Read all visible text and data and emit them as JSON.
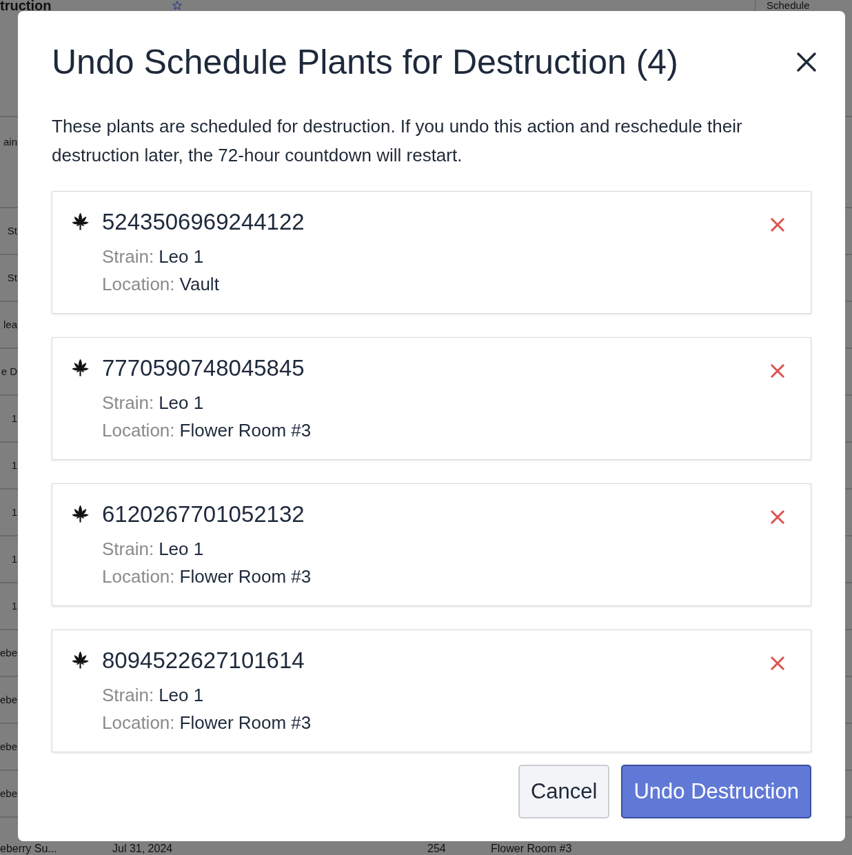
{
  "background_page": {
    "heading": "truction",
    "tab": "Schedule",
    "table": {
      "header": "ain",
      "rows": [
        {
          "cells": [
            "St"
          ]
        },
        {
          "cells": [
            "St"
          ]
        },
        {
          "cells": [
            "lea"
          ]
        },
        {
          "cells": [
            "e D"
          ]
        },
        {
          "cells": [
            "1"
          ]
        },
        {
          "cells": [
            "1"
          ]
        },
        {
          "cells": [
            "1"
          ]
        },
        {
          "cells": [
            "1"
          ]
        },
        {
          "cells": [
            "1"
          ]
        },
        {
          "cells": [
            "ebe"
          ]
        },
        {
          "cells": [
            "ebe"
          ]
        },
        {
          "cells": [
            "ebe"
          ]
        },
        {
          "cells": [
            "ebe"
          ]
        },
        {
          "cells": [
            "eberry Su...",
            "Jul 31, 2024",
            "254",
            "Flower Room #3"
          ]
        }
      ]
    }
  },
  "modal": {
    "title": "Undo Schedule Plants for Destruction (4)",
    "description": "These plants are scheduled for destruction. If you undo this action and reschedule their destruction later, the 72-hour countdown will restart.",
    "plants": [
      {
        "id": "5243506969244122",
        "strain_label": "Strain:",
        "strain": "Leo 1",
        "location_label": "Location:",
        "location": "Vault"
      },
      {
        "id": "7770590748045845",
        "strain_label": "Strain:",
        "strain": "Leo 1",
        "location_label": "Location:",
        "location": "Flower Room #3"
      },
      {
        "id": "6120267701052132",
        "strain_label": "Strain:",
        "strain": "Leo 1",
        "location_label": "Location:",
        "location": "Flower Room #3"
      },
      {
        "id": "8094522627101614",
        "strain_label": "Strain:",
        "strain": "Leo 1",
        "location_label": "Location:",
        "location": "Flower Room #3"
      }
    ],
    "buttons": [
      {
        "label": "Cancel",
        "kind": "secondary"
      },
      {
        "label": "Undo Destruction",
        "kind": "primary"
      }
    ]
  }
}
